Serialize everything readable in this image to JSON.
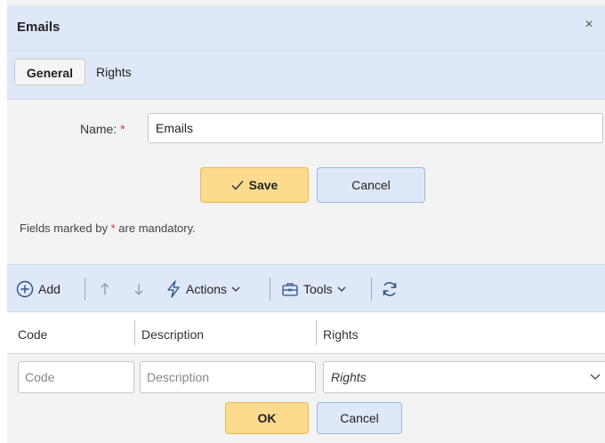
{
  "dialog": {
    "title": "Emails",
    "close_glyph": "×"
  },
  "tabs": [
    {
      "label": "General",
      "active": true
    },
    {
      "label": "Rights",
      "active": false
    }
  ],
  "form": {
    "name_label": "Name:",
    "required_mark": "*",
    "name_value": "Emails",
    "save_label": "Save",
    "cancel_label": "Cancel",
    "mandatory_prefix": "Fields marked by",
    "mandatory_suffix": "are mandatory."
  },
  "toolbar": {
    "add_label": "Add",
    "actions_label": "Actions",
    "tools_label": "Tools",
    "icons": [
      "plus-circle-icon",
      "arrow-up-icon",
      "arrow-down-icon",
      "lightning-icon",
      "toolbox-icon",
      "refresh-icon"
    ]
  },
  "grid": {
    "columns": [
      "Code",
      "Description",
      "Rights"
    ],
    "edit_row": {
      "code_placeholder": "Code",
      "description_placeholder": "Description",
      "rights_value": "Rights",
      "ok_label": "OK",
      "cancel_label": "Cancel"
    }
  },
  "colors": {
    "header_bg": "#dfe8f8",
    "primary_btn": "#fcdb8f",
    "secondary_btn": "#dfe8f8",
    "required": "#dd3333"
  }
}
